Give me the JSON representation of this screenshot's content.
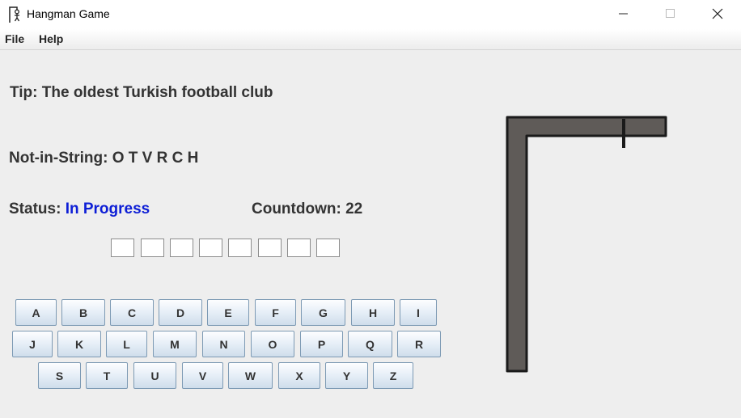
{
  "window": {
    "title": "Hangman Game"
  },
  "menu": {
    "file": "File",
    "help": "Help"
  },
  "tip": {
    "label": "Tip:",
    "value": "The oldest Turkish football club"
  },
  "not_in_string": {
    "label": "Not-in-String:",
    "value": "O T V R C H"
  },
  "status": {
    "label": "Status:",
    "value": "In Progress",
    "color": "#0d1ed6"
  },
  "countdown": {
    "label": "Countdown:",
    "value": "22"
  },
  "word_slots": [
    "",
    "",
    "",
    "",
    "",
    "",
    "",
    ""
  ],
  "keyboard": {
    "row1": [
      "A",
      "B",
      "C",
      "D",
      "E",
      "F",
      "G",
      "H",
      "I"
    ],
    "row2": [
      "J",
      "K",
      "L",
      "M",
      "N",
      "O",
      "P",
      "Q",
      "R"
    ],
    "row3": [
      "S",
      "T",
      "U",
      "V",
      "W",
      "X",
      "Y",
      "Z"
    ]
  }
}
